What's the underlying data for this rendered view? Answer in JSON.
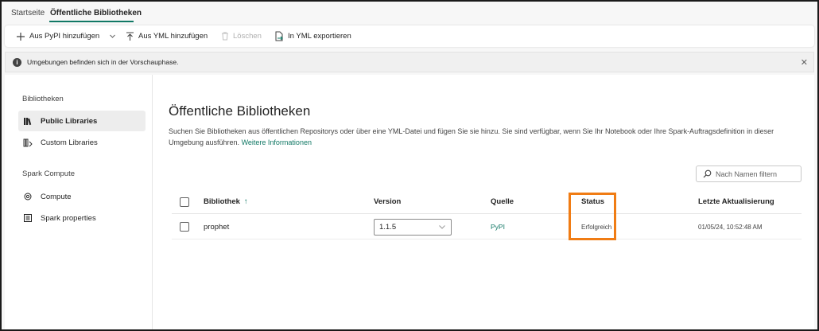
{
  "tabs": [
    {
      "label": "Startseite",
      "active": false
    },
    {
      "label": "Öffentliche Bibliotheken",
      "active": true
    }
  ],
  "toolbar": {
    "add_pypi": "Aus PyPI hinzufügen",
    "add_yml": "Aus YML hinzufügen",
    "delete": "Löschen",
    "export_yml": "In YML exportieren"
  },
  "banner": {
    "text": "Umgebungen befinden sich in der Vorschauphase."
  },
  "sidebar": {
    "section1": "Bibliotheken",
    "section2": "Spark Compute",
    "items": [
      {
        "label": "Public Libraries",
        "icon": "books-icon",
        "active": true
      },
      {
        "label": "Custom Libraries",
        "icon": "custom-books-icon",
        "active": false
      },
      {
        "label": "Compute",
        "icon": "gear-icon",
        "active": false
      },
      {
        "label": "Spark properties",
        "icon": "properties-icon",
        "active": false
      }
    ]
  },
  "main": {
    "title": "Öffentliche Bibliotheken",
    "description": "Suchen Sie Bibliotheken aus öffentlichen Repositorys oder über eine YML-Datei und fügen Sie sie hinzu. Sie sind verfügbar, wenn Sie Ihr Notebook oder Ihre Spark-Auftragsdefinition in dieser Umgebung ausführen.",
    "link": "Weitere Informationen",
    "filter_placeholder": "Nach Namen filtern"
  },
  "table": {
    "headers": {
      "library": "Bibliothek",
      "version": "Version",
      "source": "Quelle",
      "status": "Status",
      "updated": "Letzte Aktualisierung"
    },
    "sort_indicator": "↑",
    "rows": [
      {
        "library": "prophet",
        "version": "1.1.5",
        "source": "PyPI",
        "status": "Erfolgreich",
        "updated": "01/05/24, 10:52:48 AM"
      }
    ]
  },
  "colors": {
    "accent": "#117865",
    "highlight": "#f07c14"
  }
}
